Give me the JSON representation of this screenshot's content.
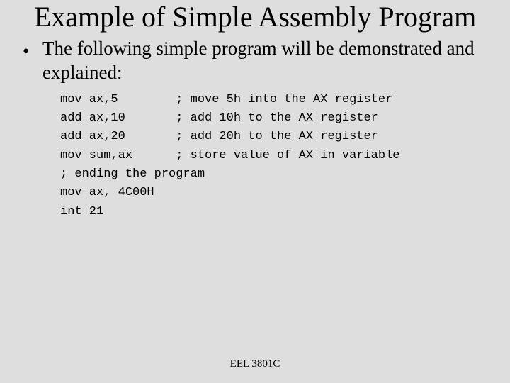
{
  "title": "Example of Simple Assembly Program",
  "bullet": "The following simple program will be demonstrated and explained:",
  "code": "mov ax,5        ; move 5h into the AX register\nadd ax,10       ; add 10h to the AX register\nadd ax,20       ; add 20h to the AX register\nmov sum,ax      ; store value of AX in variable\n; ending the program\nmov ax, 4C00H\nint 21",
  "footer": "EEL 3801C"
}
